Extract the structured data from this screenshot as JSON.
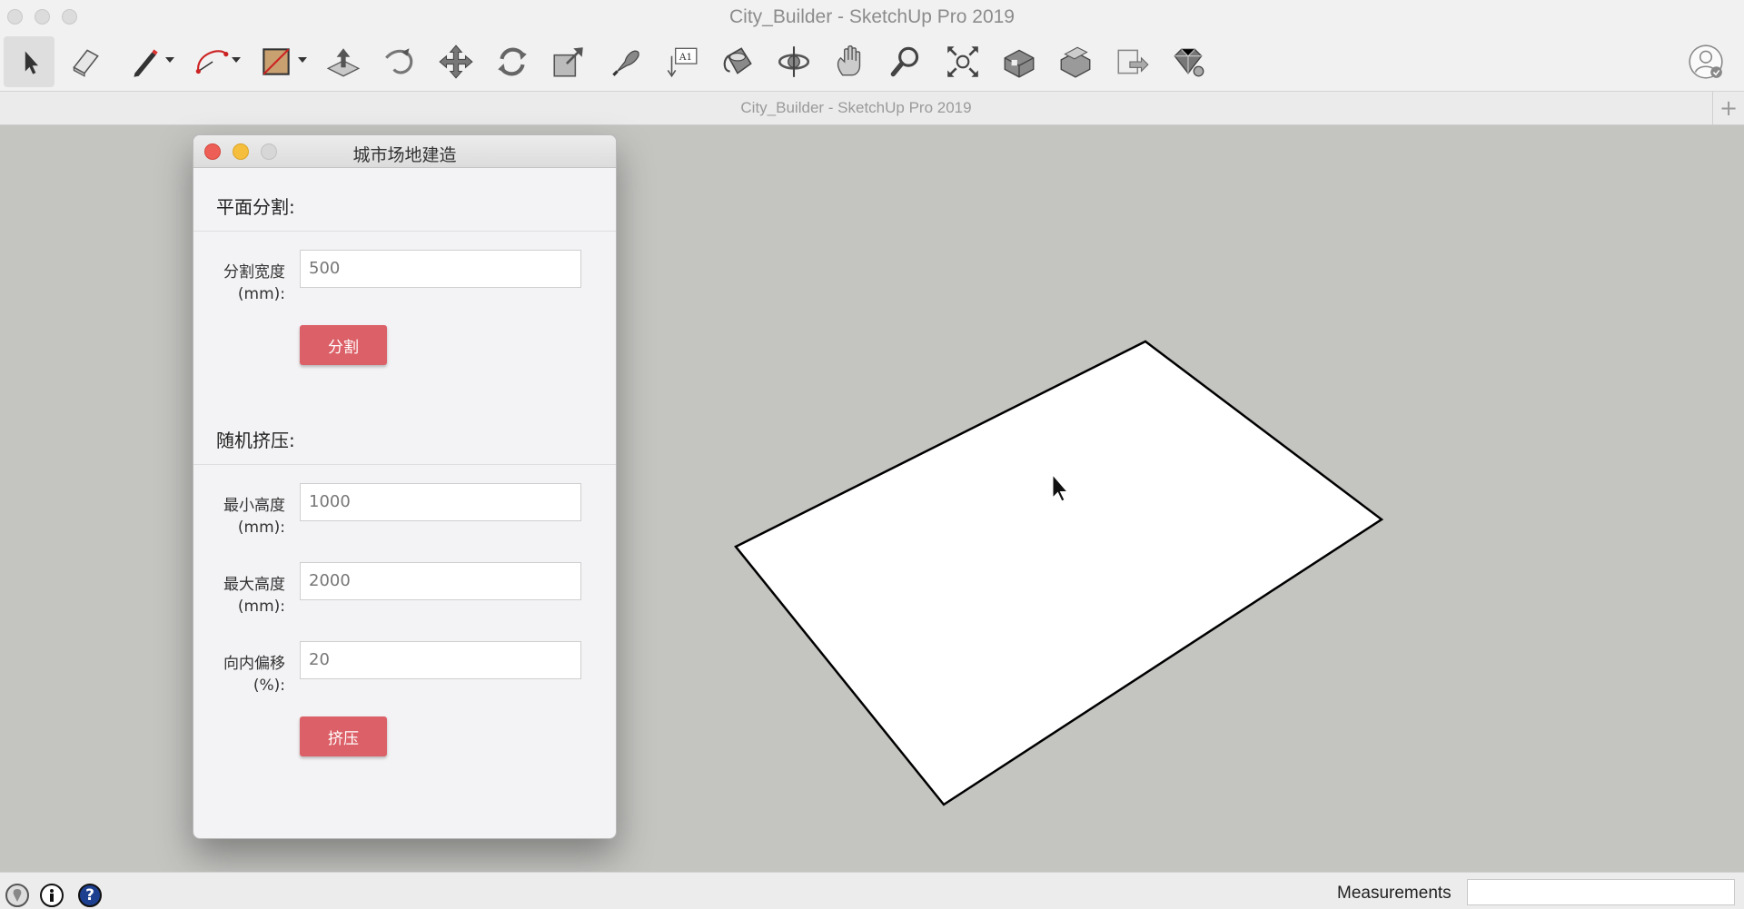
{
  "window": {
    "title": "City_Builder - SketchUp Pro 2019"
  },
  "toolbar": {
    "tools": [
      "select-tool",
      "eraser-tool",
      "pencil-tool",
      "arc-tool",
      "rectangle-tool",
      "push-pull-tool",
      "follow-me-tool",
      "move-tool",
      "rotate-tool",
      "scale-tool",
      "tape-measure-tool",
      "text-tool",
      "paint-bucket-tool",
      "orbit-tool",
      "pan-tool",
      "zoom-tool",
      "zoom-extents-tool",
      "warehouse-tool",
      "extension-warehouse-tool",
      "layout-tool",
      "extension-manager-tool"
    ],
    "account_icon": "account-icon"
  },
  "tab": {
    "title": "City_Builder - SketchUp Pro 2019",
    "add": "+"
  },
  "dialog": {
    "title": "城市场地建造",
    "split_section": {
      "title": "平面分割:",
      "width_label_line1": "分割宽度",
      "width_label_line2": "(mm):",
      "width_value": "500",
      "split_button": "分割"
    },
    "extrude_section": {
      "title": "随机挤压:",
      "min_label_line1": "最小高度",
      "min_label_line2": "(mm):",
      "min_value": "1000",
      "max_label_line1": "最大高度",
      "max_label_line2": "(mm):",
      "max_value": "2000",
      "offset_label_line1": "向内偏移",
      "offset_label_line2": "(%):",
      "offset_value": "20",
      "extrude_button": "挤压"
    }
  },
  "statusbar": {
    "icons": [
      "geo-location-icon",
      "credits-icon",
      "help-icon"
    ],
    "help_glyph": "?",
    "measurements_label": "Measurements",
    "measurements_value": ""
  },
  "colors": {
    "accent_button": "#dc6067",
    "viewport_bg": "#c4c4c1",
    "face": "#ffffff"
  }
}
